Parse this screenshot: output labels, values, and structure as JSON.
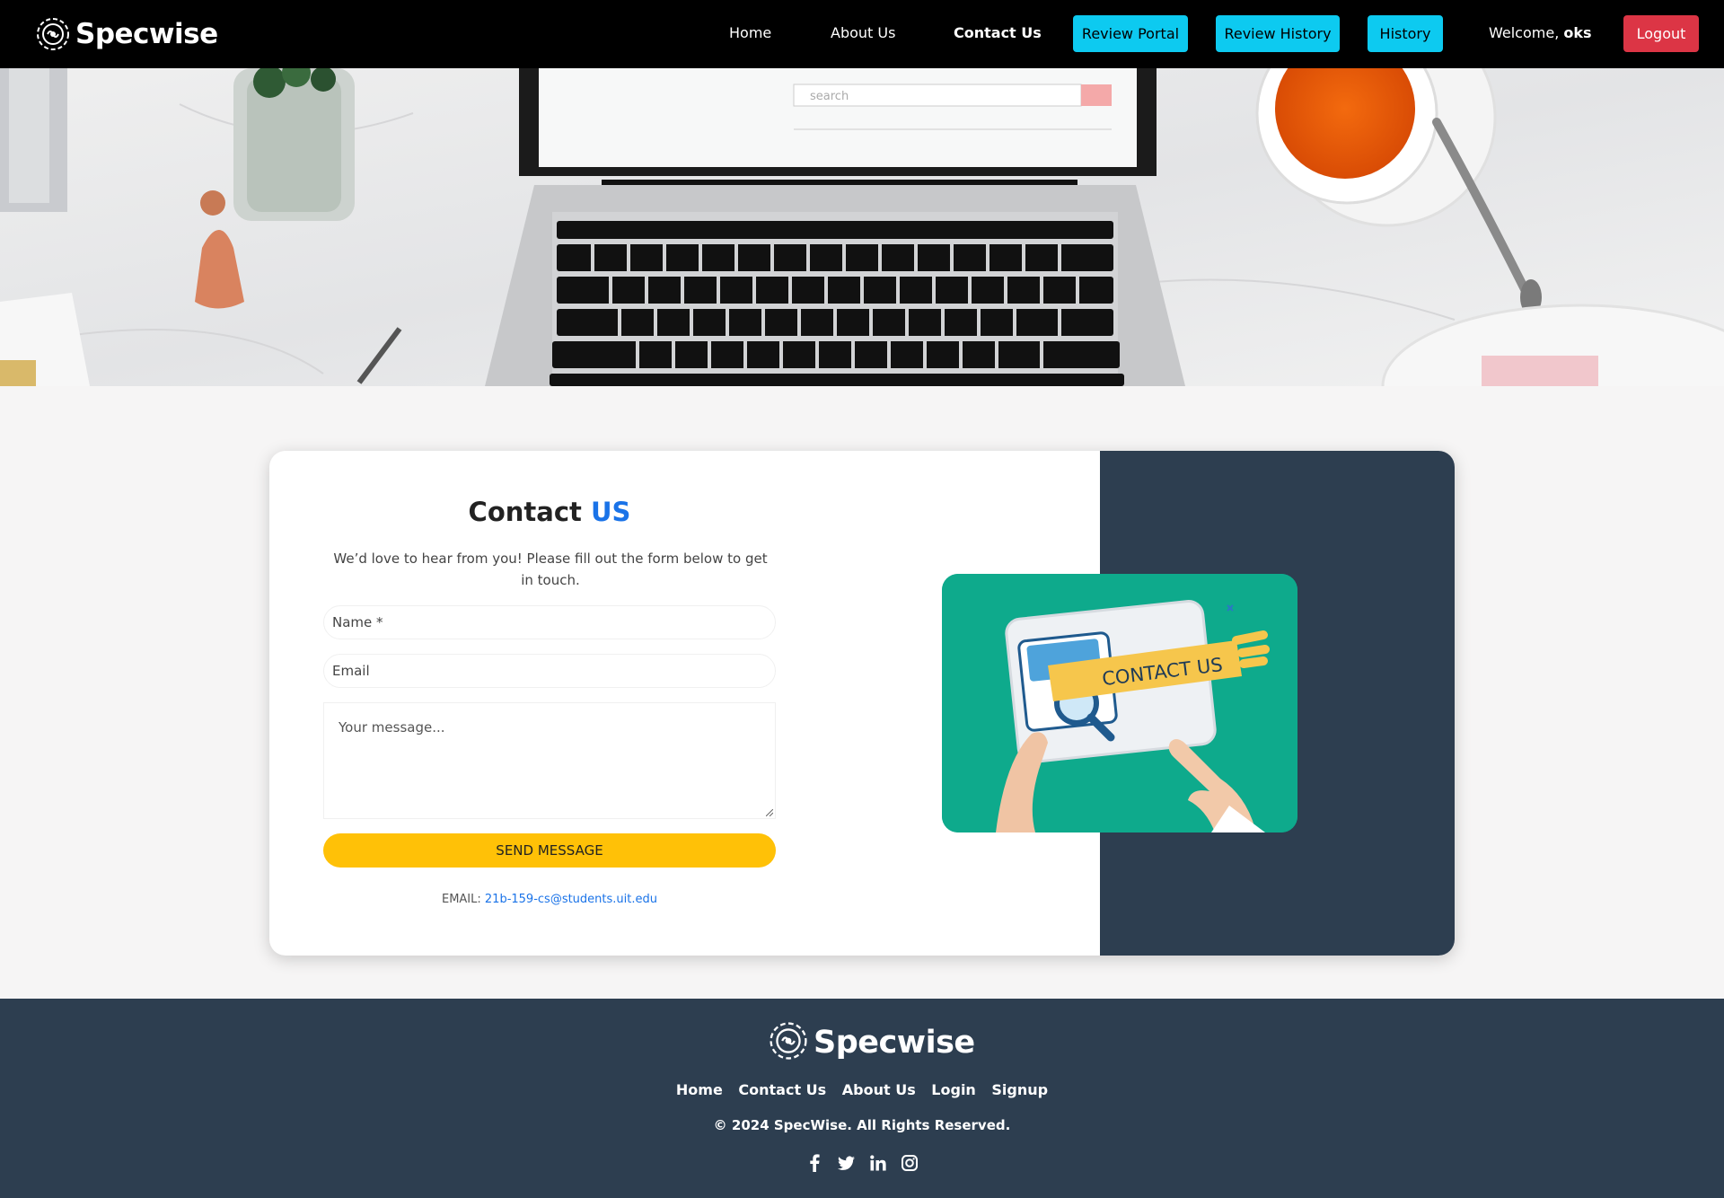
{
  "navbar": {
    "brand": "Specwise",
    "links": [
      "Home",
      "About Us",
      "Contact Us"
    ],
    "buttons": [
      "Review Portal",
      "Review History",
      "History"
    ],
    "welcome_prefix": "Welcome, ",
    "username": "oks",
    "logout": "Logout"
  },
  "contact": {
    "title_main": "Contact",
    "title_accent": "US",
    "subtitle": "We’d love to hear from you! Please fill out the form below to get in touch.",
    "name_placeholder": "Name *",
    "email_placeholder": "Email",
    "message_placeholder": "Your message...",
    "send_label": "SEND MESSAGE",
    "email_label": "EMAIL:",
    "email_value": "21b-159-cs@students.uit.edu",
    "illustration_text": "CONTACT US"
  },
  "hero": {
    "search_placeholder": "search"
  },
  "footer": {
    "brand": "Specwise",
    "links": [
      "Home",
      "Contact Us",
      "About Us",
      "Login",
      "Signup"
    ],
    "copyright": "© 2024 SpecWise. All Rights Reserved.",
    "social_icons": [
      "facebook-icon",
      "twitter-icon",
      "linkedin-icon",
      "instagram-icon"
    ]
  },
  "colors": {
    "navbar_bg": "#000000",
    "cyan_button": "#0dcaf0",
    "logout_red": "#dc3545",
    "accent_blue": "#1a73e8",
    "send_yellow": "#ffc107",
    "dark_panel": "#2d3e50",
    "illustration_green": "#0eaa8c"
  }
}
